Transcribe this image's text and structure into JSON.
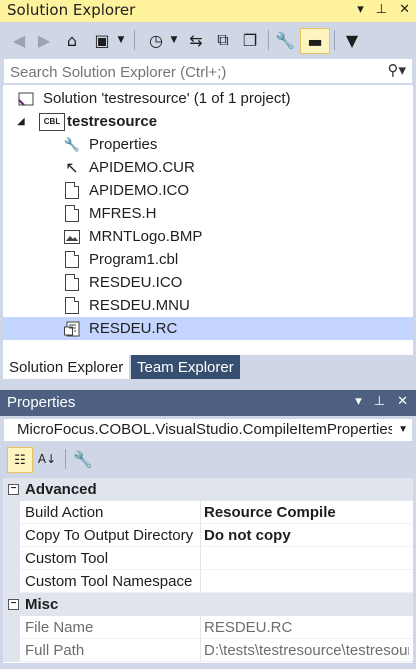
{
  "solution_explorer": {
    "title": "Solution Explorer",
    "search_placeholder": "Search Solution Explorer (Ctrl+;)",
    "toolbar_icons": [
      "back-icon",
      "forward-icon",
      "home-icon",
      "switch-views-icon",
      "dropdown-icon",
      "pending-changes-icon",
      "dropdown-icon",
      "sync-icon",
      "collapse-all-icon",
      "show-all-files-icon",
      "properties-icon",
      "preview-selected-icon",
      "filter-icon"
    ],
    "tree": {
      "solution": "Solution 'testresource' (1 of 1 project)",
      "project": "testresource",
      "project_badge": "CBL",
      "items": [
        {
          "label": "Properties",
          "icon": "wrench-icon"
        },
        {
          "label": "APIDEMO.CUR",
          "icon": "cursor-file-icon"
        },
        {
          "label": "APIDEMO.ICO",
          "icon": "icon-file-icon"
        },
        {
          "label": "MFRES.H",
          "icon": "header-file-icon"
        },
        {
          "label": "MRNTLogo.BMP",
          "icon": "image-file-icon"
        },
        {
          "label": "Program1.cbl",
          "icon": "cobol-file-icon"
        },
        {
          "label": "RESDEU.ICO",
          "icon": "icon-file-icon"
        },
        {
          "label": "RESDEU.MNU",
          "icon": "file-icon"
        },
        {
          "label": "RESDEU.RC",
          "icon": "resource-file-icon"
        }
      ]
    },
    "tabs": [
      "Solution Explorer",
      "Team Explorer"
    ]
  },
  "properties": {
    "title": "Properties",
    "object": "MicroFocus.COBOL.VisualStudio.CompileItemProperties.I",
    "categories": [
      {
        "name": "Advanced",
        "rows": [
          {
            "key": "Build Action",
            "value": "Resource Compile"
          },
          {
            "key": "Copy To Output Directory",
            "value": "Do not copy"
          },
          {
            "key": "Custom Tool",
            "value": ""
          },
          {
            "key": "Custom Tool Namespace",
            "value": ""
          }
        ]
      },
      {
        "name": "Misc",
        "rows": [
          {
            "key": "File Name",
            "value": "RESDEU.RC"
          },
          {
            "key": "Full Path",
            "value": "D:\\tests\\testresource\\testresour"
          }
        ]
      }
    ]
  },
  "colors": {
    "title_active": "#fff29d",
    "title_inactive": "#4d6082",
    "selection": "#c4d5ff",
    "tab_inactive": "#364e6f"
  }
}
